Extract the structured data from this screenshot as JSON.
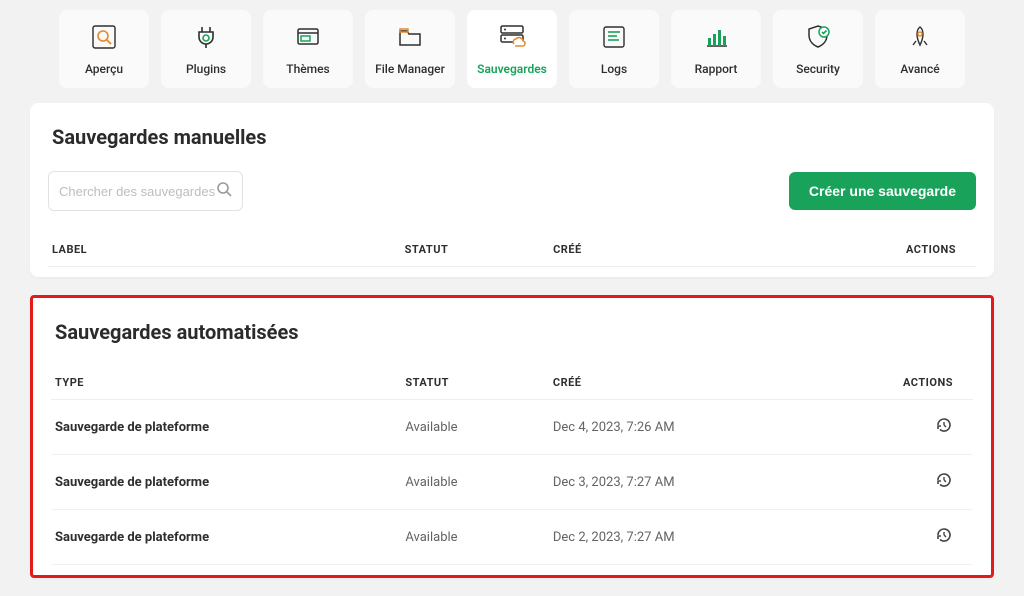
{
  "tabs": [
    {
      "id": "overview",
      "label": "Aperçu",
      "icon": "magnifier"
    },
    {
      "id": "plugins",
      "label": "Plugins",
      "icon": "plug"
    },
    {
      "id": "themes",
      "label": "Thèmes",
      "icon": "window"
    },
    {
      "id": "filemanager",
      "label": "File Manager",
      "icon": "folder"
    },
    {
      "id": "backups",
      "label": "Sauvegardes",
      "icon": "server-cloud"
    },
    {
      "id": "logs",
      "label": "Logs",
      "icon": "lines"
    },
    {
      "id": "report",
      "label": "Rapport",
      "icon": "bars"
    },
    {
      "id": "security",
      "label": "Security",
      "icon": "shield"
    },
    {
      "id": "advanced",
      "label": "Avancé",
      "icon": "rocket"
    }
  ],
  "active_tab": "backups",
  "manual": {
    "title": "Sauvegardes manuelles",
    "search_placeholder": "Chercher des sauvegardes",
    "create_label": "Créer une sauvegarde",
    "columns": {
      "label": "LABEL",
      "status": "STATUT",
      "created": "CRÉÉ",
      "actions": "ACTIONS"
    }
  },
  "auto": {
    "title": "Sauvegardes automatisées",
    "columns": {
      "type": "TYPE",
      "status": "STATUT",
      "created": "CRÉÉ",
      "actions": "ACTIONS"
    },
    "rows": [
      {
        "type": "Sauvegarde de plateforme",
        "status": "Available",
        "created": "Dec 4, 2023, 7:26 AM"
      },
      {
        "type": "Sauvegarde de plateforme",
        "status": "Available",
        "created": "Dec 3, 2023, 7:27 AM"
      },
      {
        "type": "Sauvegarde de plateforme",
        "status": "Available",
        "created": "Dec 2, 2023, 7:27 AM"
      }
    ]
  },
  "icons": {
    "restore": "restore-icon"
  }
}
